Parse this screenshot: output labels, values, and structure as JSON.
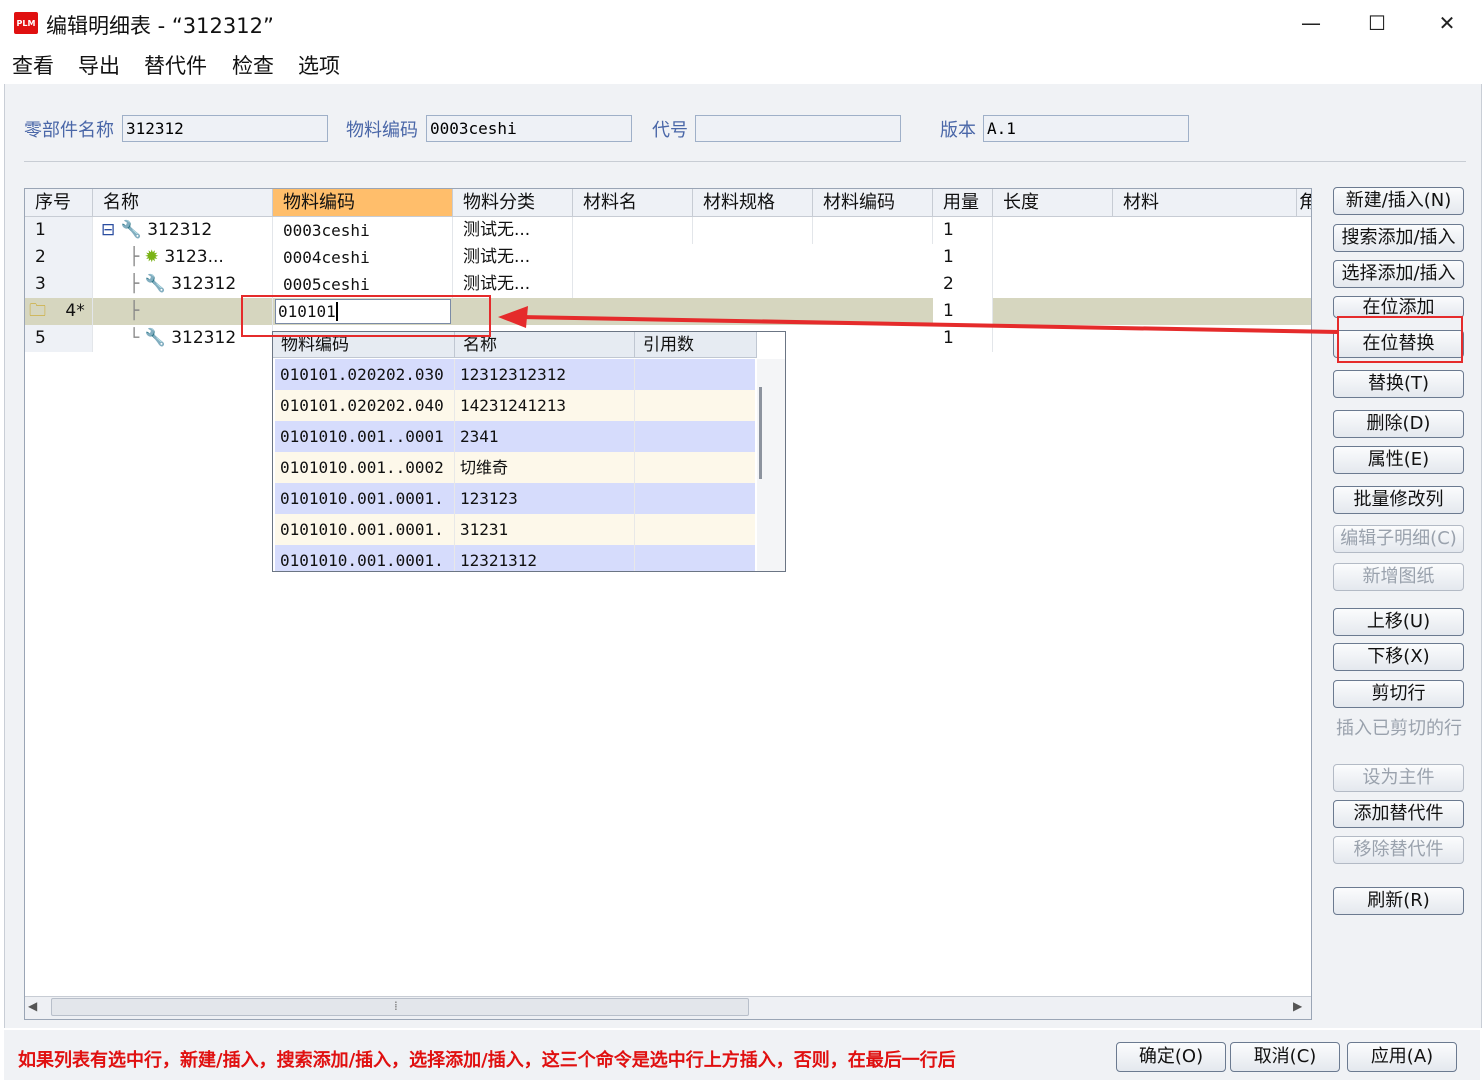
{
  "window": {
    "title": "编辑明细表 - “312312”",
    "icon_text": "PLM",
    "minimize": "—",
    "maximize": "☐",
    "close": "✕"
  },
  "menu": [
    "查看",
    "导出",
    "替代件",
    "检查",
    "选项"
  ],
  "fields": {
    "part_name_label": "零部件名称",
    "part_name_value": "312312",
    "material_code_label": "物料编码",
    "material_code_value": "0003ceshi",
    "code_label": "代号",
    "code_value": "",
    "version_label": "版本",
    "version_value": "A.1"
  },
  "table": {
    "columns": [
      "序号",
      "名称",
      "物料编码",
      "物料分类",
      "材料名",
      "材料规格",
      "材料编码",
      "用量",
      "长度",
      "材料",
      "角"
    ],
    "rows": [
      {
        "seq": "1",
        "tree": "⊟",
        "name": "312312",
        "code": "0003ceshi",
        "category": "测试无...",
        "qty": "1"
      },
      {
        "seq": "2",
        "tree": "├",
        "name": "3123...",
        "code": "0004ceshi",
        "category": "测试无...",
        "qty": "1"
      },
      {
        "seq": "3",
        "tree": "├",
        "name": "312312",
        "code": "0005ceshi",
        "category": "测试无...",
        "qty": "2"
      },
      {
        "seq": "4*",
        "tree": "├",
        "name": "",
        "code": "010101",
        "category": "",
        "qty": "1"
      },
      {
        "seq": "5",
        "tree": "└",
        "name": "312312",
        "code": "",
        "category": "",
        "qty": "1"
      }
    ]
  },
  "dropdown": {
    "columns": [
      "物料编码",
      "名称",
      "引用数"
    ],
    "rows": [
      {
        "code": "010101.020202.030",
        "name": "12312312312",
        "refs": ""
      },
      {
        "code": "010101.020202.040",
        "name": "14231241213",
        "refs": ""
      },
      {
        "code": "0101010.001..0001",
        "name": "2341",
        "refs": ""
      },
      {
        "code": "0101010.001..0002",
        "name": "切维奇",
        "refs": ""
      },
      {
        "code": "0101010.001.0001.",
        "name": "123123",
        "refs": ""
      },
      {
        "code": "0101010.001.0001.",
        "name": "31231",
        "refs": ""
      },
      {
        "code": "0101010.001.0001.",
        "name": "12321312",
        "refs": ""
      }
    ]
  },
  "buttons": {
    "new_insert": "新建/插入(N)",
    "search_add": "搜索添加/插入",
    "select_add": "选择添加/插入",
    "inplace_add": "在位添加",
    "inplace_replace": "在位替换",
    "replace": "替换(T)",
    "delete": "删除(D)",
    "props": "属性(E)",
    "batch_edit": "批量修改列",
    "edit_child": "编辑子明细(C)",
    "new_drawing": "新增图纸",
    "move_up": "上移(U)",
    "move_down": "下移(X)",
    "cut_row": "剪切行",
    "insert_cut": "插入已剪切的行",
    "set_main": "设为主件",
    "add_alt": "添加替代件",
    "remove_alt": "移除替代件",
    "refresh": "刷新(R)"
  },
  "status": {
    "hint": "如果列表有选中行，新建/插入，搜索添加/插入，选择添加/插入，这三个命令是选中行上方插入，否则，在最后一行后",
    "ok": "确定(O)",
    "cancel": "取消(C)",
    "apply": "应用(A)"
  },
  "scroll_marker": "⁞",
  "colors": {
    "accent": "#ffbe6b",
    "selected_row": "#d6d6bf",
    "annotation": "#e52b2b",
    "hint": "#e01010"
  }
}
